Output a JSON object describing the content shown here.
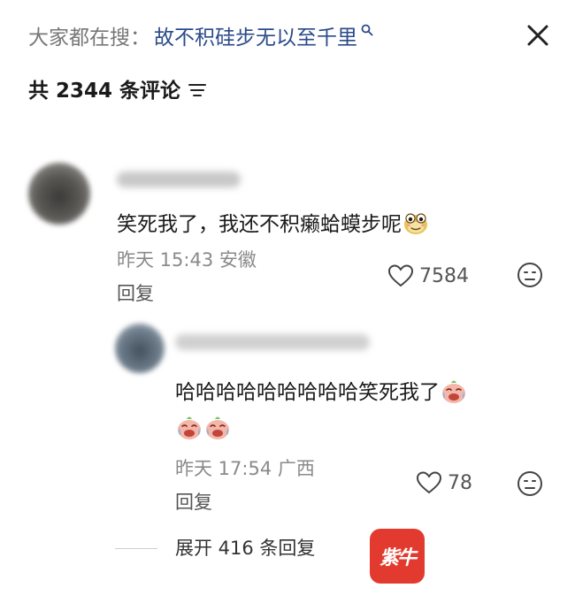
{
  "search": {
    "prefix": "大家都在搜：",
    "term": "故不积硅步无以至千里"
  },
  "header": {
    "comment_count_label": "共 2344 条评论"
  },
  "comments": [
    {
      "text": "笑死我了，我还不积癞蛤蟆步呢",
      "time": "昨天 15:43",
      "location": "安徽",
      "reply_label": "回复",
      "likes": "7584",
      "emoji": "toad-emoji"
    }
  ],
  "replies": [
    {
      "text": "哈哈哈哈哈哈哈哈哈笑死我了",
      "time": "昨天 17:54",
      "location": "广西",
      "reply_label": "回复",
      "likes": "78",
      "emoji": "crying-laughing-emoji"
    }
  ],
  "expand": {
    "label": "展开 416 条回复"
  },
  "watermark": {
    "text": "紫牛"
  },
  "colors": {
    "search_term": "#2b4a8a",
    "meta": "#8a8a8a",
    "watermark_bg": "#e23a2e"
  }
}
